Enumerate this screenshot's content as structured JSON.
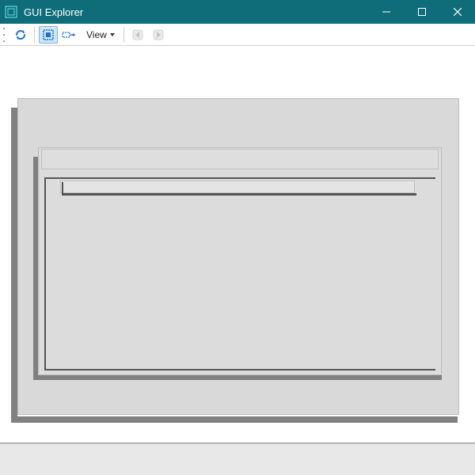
{
  "window": {
    "title": "GUI Explorer"
  },
  "toolbar": {
    "view_label": "View"
  }
}
